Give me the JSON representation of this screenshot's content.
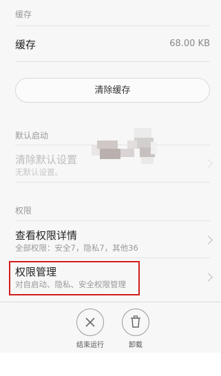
{
  "cache_section": {
    "header": "缓存",
    "row_label": "缓存",
    "row_value": "68.00 KB",
    "clear_button_label": "清除缓存"
  },
  "default_launch_section": {
    "header": "默认启动",
    "row_title": "清除默认设置",
    "row_subtitle": "无默认设置。"
  },
  "permissions_section": {
    "header": "权限",
    "details_title": "查看权限详情",
    "details_subtitle": "全部权限：安全7，隐私7，其他36",
    "manage_title": "权限管理",
    "manage_subtitle": "对自启动、隐私、安全权限管理"
  },
  "bottom_actions": {
    "stop_label": "结束运行",
    "uninstall_label": "卸载"
  },
  "colors": {
    "highlight_border": "#d21b1b",
    "background": "#f7f7f7"
  }
}
